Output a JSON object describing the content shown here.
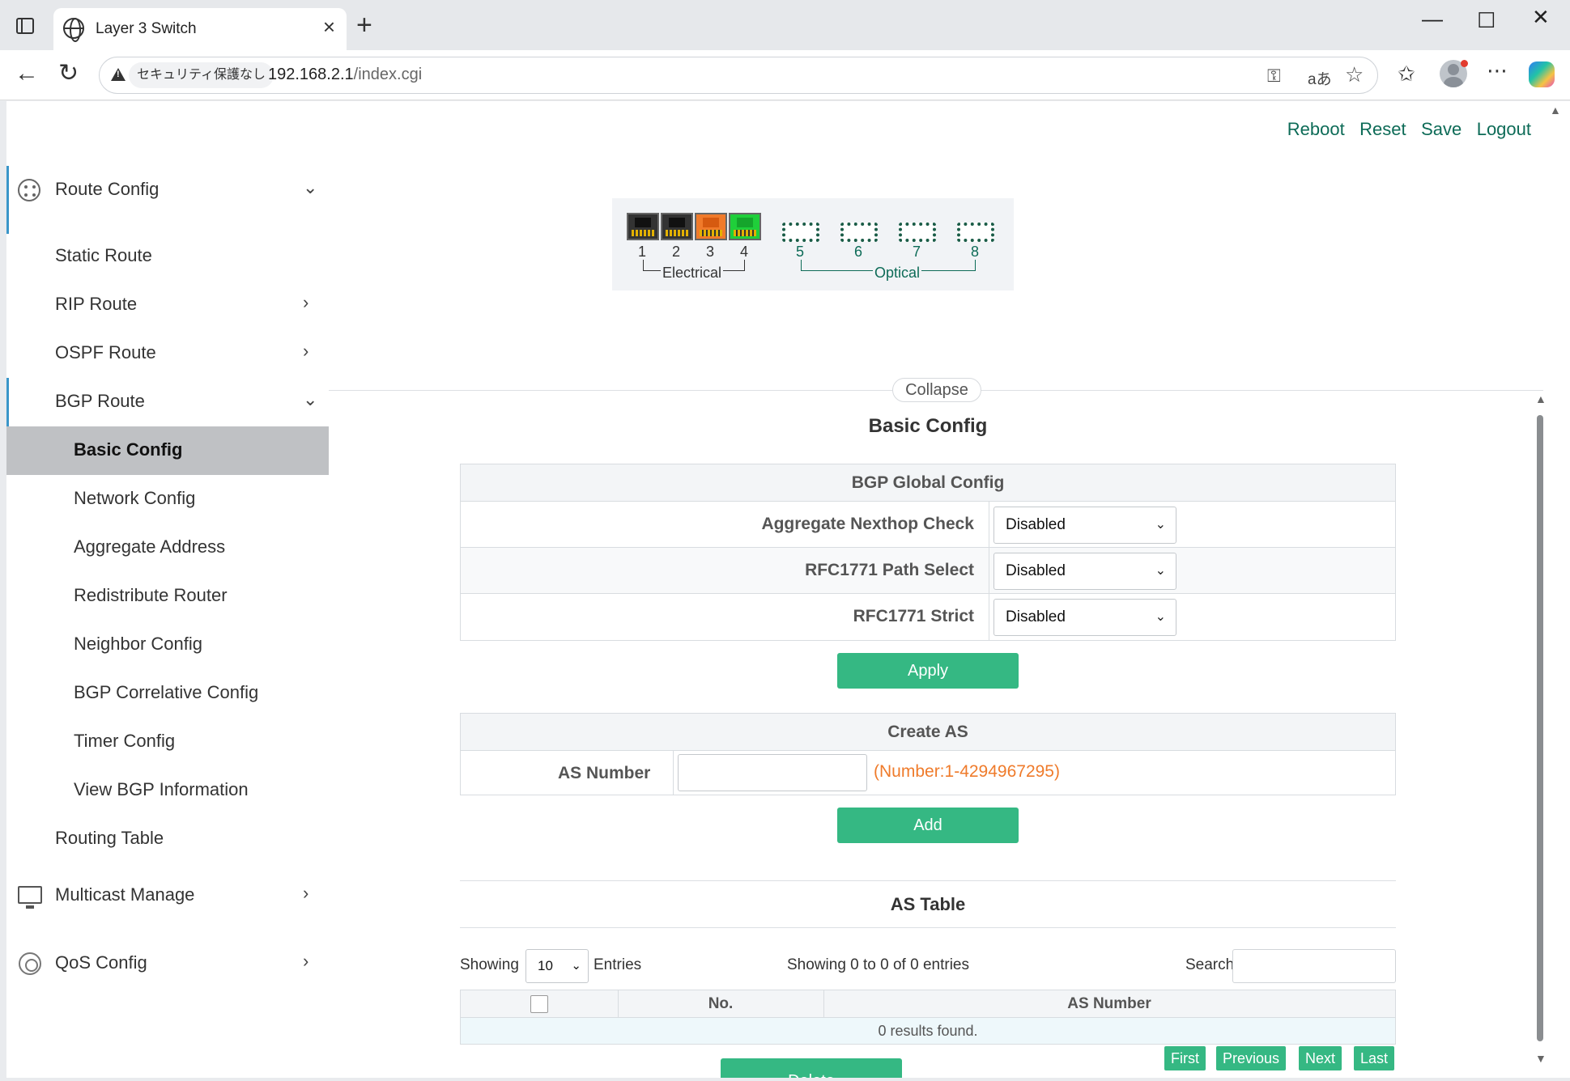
{
  "browser": {
    "tab_title": "Layer 3 Switch",
    "security_label": "セキュリティ保護なし",
    "url_host": "192.168.2.1",
    "url_path": "/index.cgi",
    "read_aloud_label": "aあ"
  },
  "top_links": [
    "Reboot",
    "Reset",
    "Save",
    "Logout"
  ],
  "ports": {
    "electrical": {
      "label": "Electrical",
      "numbers": [
        "1",
        "2",
        "3",
        "4"
      ],
      "states": [
        "off",
        "off",
        "orange",
        "green"
      ]
    },
    "optical": {
      "label": "Optical",
      "numbers": [
        "5",
        "6",
        "7",
        "8"
      ]
    }
  },
  "sidebar": {
    "route_config": "Route Config",
    "static_route": "Static Route",
    "rip_route": "RIP Route",
    "ospf_route": "OSPF Route",
    "bgp_route": "BGP Route",
    "bgp_items": [
      "Basic Config",
      "Network Config",
      "Aggregate Address",
      "Redistribute Router",
      "Neighbor Config",
      "BGP Correlative Config",
      "Timer Config",
      "View BGP Information"
    ],
    "routing_table": "Routing Table",
    "multicast_manage": "Multicast Manage",
    "qos_config": "QoS Config"
  },
  "main": {
    "collapse_label": "Collapse",
    "page_title": "Basic Config",
    "global_config": {
      "title": "BGP Global Config",
      "rows": [
        {
          "label": "Aggregate Nexthop Check",
          "value": "Disabled"
        },
        {
          "label": "RFC1771 Path Select",
          "value": "Disabled"
        },
        {
          "label": "RFC1771 Strict",
          "value": "Disabled"
        }
      ],
      "apply_label": "Apply"
    },
    "create_as": {
      "title": "Create AS",
      "label": "AS Number",
      "value": "",
      "hint": "(Number:1-4294967295)",
      "add_label": "Add"
    },
    "as_table": {
      "title": "AS Table",
      "showing_label": "Showing",
      "page_size": "10",
      "entries_label": "Entries",
      "summary": "Showing 0 to 0 of 0 entries",
      "search_label": "Search",
      "columns": [
        "No.",
        "AS Number"
      ],
      "empty": "0 results found.",
      "pagination": [
        "First",
        "Previous",
        "Next",
        "Last"
      ],
      "delete_label": "Delete"
    }
  },
  "colors": {
    "accent": "#35b883",
    "link": "#0d6b57",
    "hint": "#ef7b2b",
    "active_bg": "#bfc1c4"
  }
}
